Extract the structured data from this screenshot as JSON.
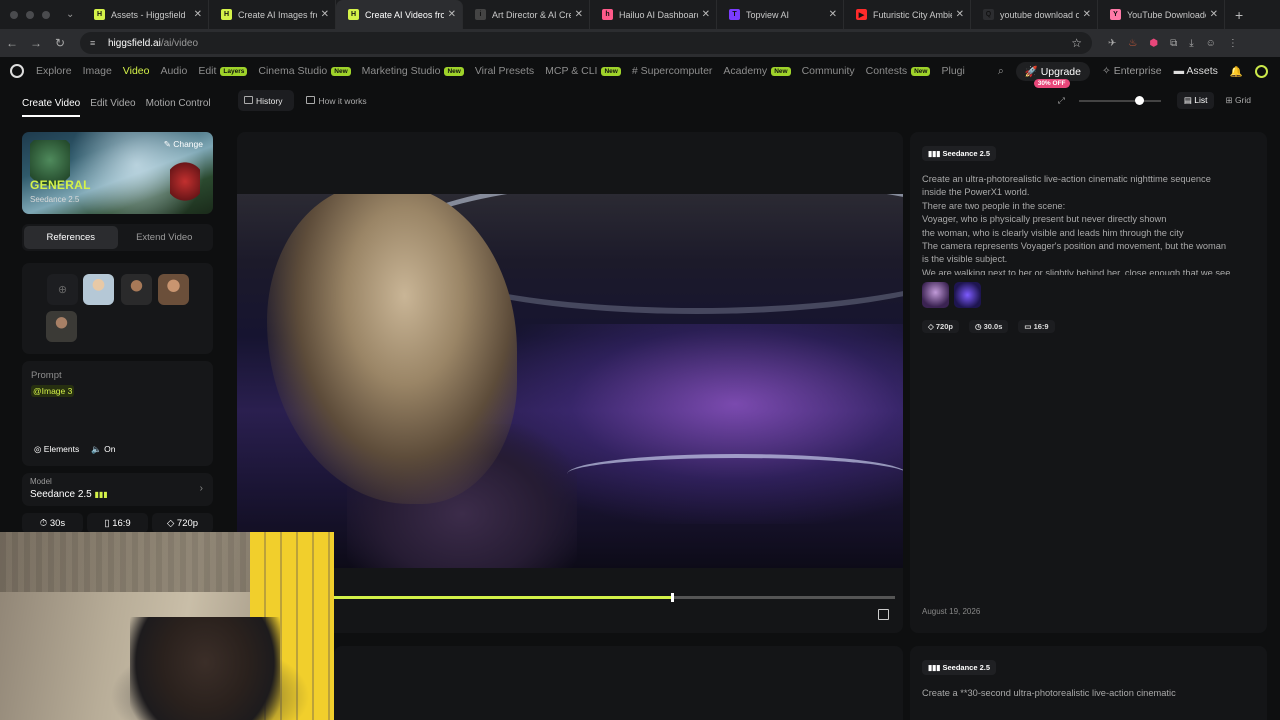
{
  "browser": {
    "tabs": [
      {
        "label": "Assets - Higgsfield",
        "fav_color": "#d4f249",
        "fav_glyph": "H",
        "active": false
      },
      {
        "label": "Create AI Images fro",
        "fav_color": "#d4f249",
        "fav_glyph": "H",
        "active": false
      },
      {
        "label": "Create AI Videos fron",
        "fav_color": "#d4f249",
        "fav_glyph": "H",
        "active": true
      },
      {
        "label": "Art Director & AI Cre",
        "fav_color": "#444444",
        "fav_glyph": "i",
        "active": false
      },
      {
        "label": "Hailuo AI Dashboard",
        "fav_color": "#ff5a8a",
        "fav_glyph": "h",
        "active": false
      },
      {
        "label": "Topview AI",
        "fav_color": "#7b3cff",
        "fav_glyph": "T",
        "active": false
      },
      {
        "label": "Futuristic City Ambie",
        "fav_color": "#ff2b2b",
        "fav_glyph": "▶",
        "active": false
      },
      {
        "label": "youtube download o",
        "fav_color": "#2c2d30",
        "fav_glyph": "Q",
        "active": false
      },
      {
        "label": "YouTube Downloader",
        "fav_color": "#ff7aa8",
        "fav_glyph": "Y",
        "active": false
      }
    ],
    "url_host": "higgsfield.ai",
    "url_path": "/ai/video"
  },
  "header": {
    "nav": [
      {
        "label": "Explore",
        "badge": "",
        "active": false
      },
      {
        "label": "Image",
        "badge": "",
        "active": false
      },
      {
        "label": "Video",
        "badge": "",
        "active": true
      },
      {
        "label": "Audio",
        "badge": "",
        "active": false
      },
      {
        "label": "Edit",
        "badge": "Layers",
        "active": false
      },
      {
        "label": "Cinema Studio",
        "badge": "New",
        "active": false
      },
      {
        "label": "Marketing Studio",
        "badge": "New",
        "active": false
      },
      {
        "label": "Viral Presets",
        "badge": "",
        "active": false
      },
      {
        "label": "MCP & CLI",
        "badge": "New",
        "active": false
      },
      {
        "label": "# Supercomputer",
        "badge": "",
        "active": false
      },
      {
        "label": "Academy",
        "badge": "New",
        "active": false
      },
      {
        "label": "Community",
        "badge": "",
        "active": false
      },
      {
        "label": "Contests",
        "badge": "New",
        "active": false
      },
      {
        "label": "Plugi",
        "badge": "",
        "active": false
      }
    ],
    "upgrade_label": "Upgrade",
    "upgrade_badge": "30% OFF",
    "enterprise_label": "Enterprise",
    "assets_label": "Assets"
  },
  "left": {
    "tabs": [
      "Create Video",
      "Edit Video",
      "Motion Control"
    ],
    "genre_title": "GENERAL",
    "genre_model": "Seedance 2.5",
    "change_label": "Change",
    "segments": [
      "References",
      "Extend Video"
    ],
    "prompt_label": "Prompt",
    "prompt_tag": "@Image 3",
    "elements_label": "Elements",
    "audio_label": "On",
    "model_label": "Model",
    "model_value": "Seedance 2.5",
    "duration": "30s",
    "aspect": "16:9",
    "resolution": "720p"
  },
  "toolbar": {
    "history_label": "History",
    "how_label": "How it works",
    "list_label": "List",
    "grid_label": "Grid",
    "zoom_level": 0.73
  },
  "player": {
    "progress": 0.6
  },
  "details": {
    "model_tag": "Seedance 2.5",
    "prompt_lines": [
      "Create an ultra-photorealistic live-action cinematic nighttime sequence",
      "inside the PowerX1 world.",
      "There are two people in the scene:",
      "Voyager, who is physically present but never directly shown",
      "the woman, who is clearly visible and leads him through the city",
      "The camera represents Voyager's position and movement, but the woman",
      "is the visible subject.",
      "We are walking next to her or slightly behind her, close enough that we see"
    ],
    "resolution": "720p",
    "duration": "30.0s",
    "aspect": "16:9",
    "date": "August 19, 2026",
    "second_model_tag": "Seedance 2.5",
    "second_prompt": "Create a **30-second ultra-photorealistic live-action cinematic"
  }
}
